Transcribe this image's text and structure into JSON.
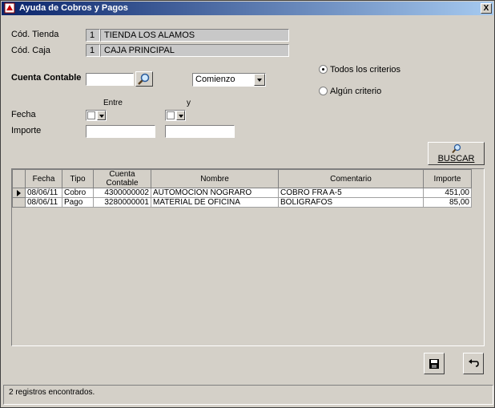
{
  "window": {
    "title": "Ayuda de Cobros y Pagos",
    "close_label": "X"
  },
  "tienda": {
    "label": "Cód. Tienda",
    "code": "1",
    "name": "TIENDA LOS ALAMOS"
  },
  "caja": {
    "label": "Cód. Caja",
    "code": "1",
    "name": "CAJA PRINCIPAL"
  },
  "cuenta": {
    "label": "Cuenta Contable",
    "value": "",
    "match_mode": "Comienzo"
  },
  "criteria": {
    "all": "Todos los criterios",
    "any": "Algún criterio",
    "selected": "all"
  },
  "fecha": {
    "label": "Fecha",
    "between_label": "Entre",
    "and_label": "y"
  },
  "importe": {
    "label": "Importe"
  },
  "buscar_label": "BUSCAR",
  "table": {
    "columns": [
      "Fecha",
      "Tipo",
      "Cuenta Contable",
      "Nombre",
      "Comentario",
      "Importe"
    ],
    "rows": [
      [
        "08/06/11",
        "Cobro",
        "4300000002",
        "AUTOMOCION NOGRARO",
        "COBRO FRA A-5",
        "451,00"
      ],
      [
        "08/06/11",
        "Pago",
        "3280000001",
        "MATERIAL DE OFICINA",
        "BOLIGRAFOS",
        "85,00"
      ]
    ]
  },
  "status": "2 registros encontrados."
}
